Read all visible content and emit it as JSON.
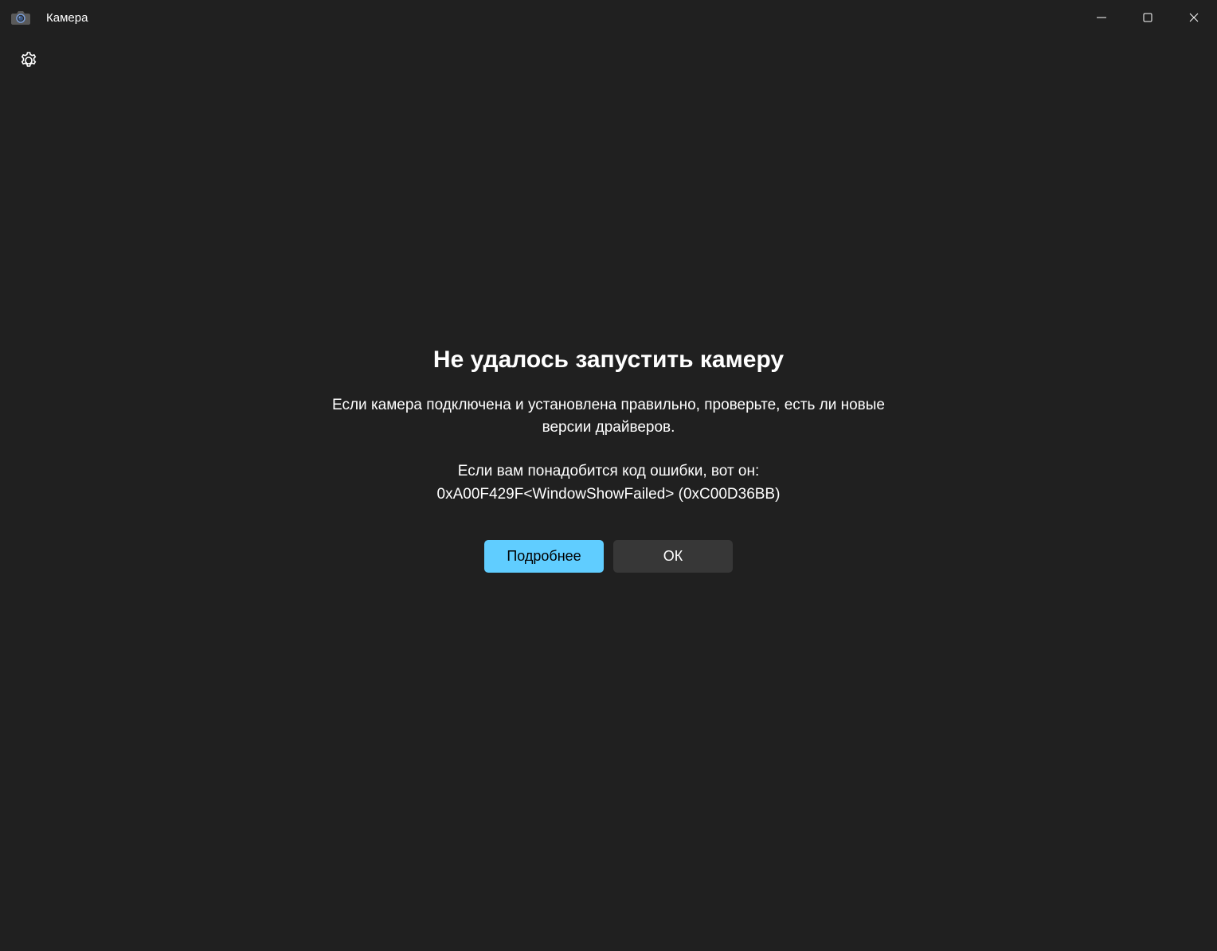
{
  "window": {
    "title": "Камера"
  },
  "error": {
    "heading": "Не удалось запустить камеру",
    "description": "Если камера подключена и установлена правильно, проверьте, есть ли новые версии драйверов.",
    "code_intro": "Если вам понадобится код ошибки, вот он:",
    "code": "0xA00F429F<WindowShowFailed> (0xC00D36BB)"
  },
  "buttons": {
    "details": "Подробнее",
    "ok": "ОК"
  }
}
